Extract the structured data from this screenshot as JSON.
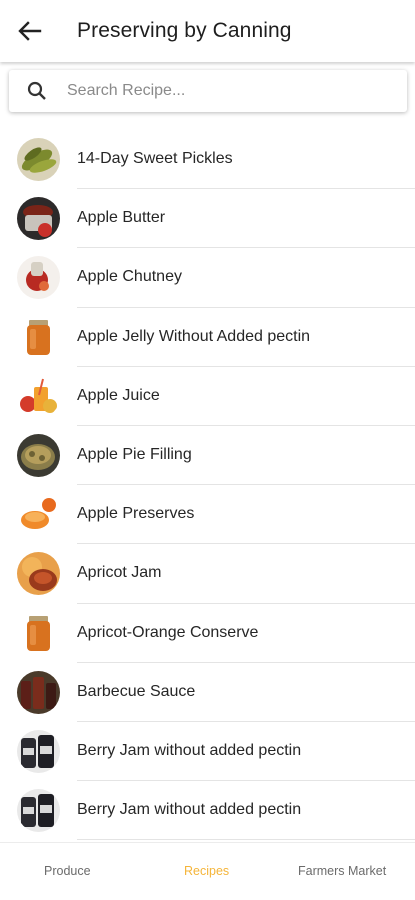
{
  "header": {
    "title": "Preserving by Canning",
    "back_icon": "arrow-left-icon"
  },
  "search": {
    "placeholder": "Search Recipe...",
    "value": "",
    "icon": "search-icon"
  },
  "recipes": [
    {
      "label": "14-Day Sweet Pickles",
      "thumb": "pickles"
    },
    {
      "label": "Apple Butter",
      "thumb": "butter"
    },
    {
      "label": "Apple Chutney",
      "thumb": "chutney"
    },
    {
      "label": "Apple Jelly Without Added pectin",
      "thumb": "jar"
    },
    {
      "label": "Apple Juice",
      "thumb": "juice"
    },
    {
      "label": "Apple Pie Filling",
      "thumb": "pie"
    },
    {
      "label": "Apple Preserves",
      "thumb": "preserves"
    },
    {
      "label": "Apricot Jam",
      "thumb": "apricot"
    },
    {
      "label": "Apricot-Orange Conserve",
      "thumb": "jar"
    },
    {
      "label": "Barbecue Sauce",
      "thumb": "bbq"
    },
    {
      "label": "Berry Jam without added pectin",
      "thumb": "berry"
    },
    {
      "label": "Berry Jam without added pectin",
      "thumb": "berry"
    }
  ],
  "bottom_nav": {
    "items": [
      {
        "label": "Produce",
        "active": false
      },
      {
        "label": "Recipes",
        "active": true
      },
      {
        "label": "Farmers Market",
        "active": false
      }
    ],
    "active_color": "#f5b53a",
    "inactive_color": "#6b6b6b"
  }
}
